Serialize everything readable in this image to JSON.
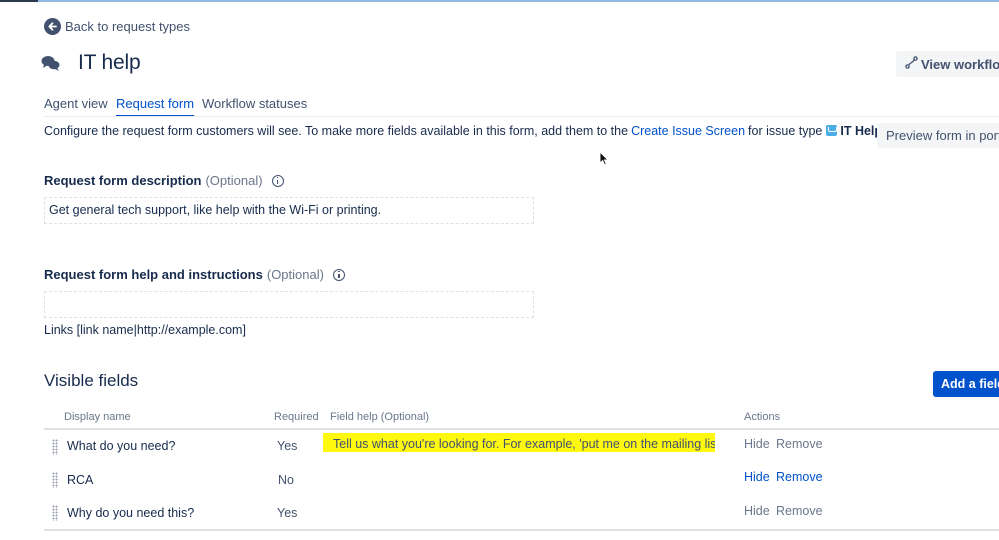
{
  "header": {
    "back_label": "Back to request types",
    "title": "IT help",
    "view_workflow_label": "View workflow",
    "title_icon": "chat-bubbles-icon"
  },
  "tabs": [
    {
      "label": "Agent view",
      "active": false
    },
    {
      "label": "Request form",
      "active": true
    },
    {
      "label": "Workflow statuses",
      "active": false
    }
  ],
  "config": {
    "text_before": "Configure the request form customers will see. To make more fields available in this form, add them to the",
    "link": "Create Issue Screen",
    "text_mid": "for issue type",
    "issue_type": "IT Help",
    "text_end": ".",
    "preview_label": "Preview form in portal"
  },
  "description": {
    "label": "Request form description",
    "optional": "(Optional)",
    "value": "Get general tech support, like help with the Wi-Fi or printing."
  },
  "instructions": {
    "label": "Request form help and instructions",
    "optional": "(Optional)",
    "value": "",
    "links_hint": "Links [link name|http://example.com]"
  },
  "visible_fields": {
    "title": "Visible fields",
    "add_label": "Add a field",
    "columns": {
      "display_name": "Display name",
      "required": "Required",
      "field_help": "Field help (Optional)",
      "actions": "Actions"
    },
    "rows": [
      {
        "name": "What do you need?",
        "required": "Yes",
        "help": "Tell us what you're looking for. For example, 'put me on the mailing list'.",
        "hide": "Hide",
        "remove": "Remove",
        "actions_active": false
      },
      {
        "name": "RCA",
        "required": "No",
        "help": "",
        "hide": "Hide",
        "remove": "Remove",
        "actions_active": true
      },
      {
        "name": "Why do you need this?",
        "required": "Yes",
        "help": "",
        "hide": "Hide",
        "remove": "Remove",
        "actions_active": false
      }
    ]
  },
  "colors": {
    "link": "#0052CC",
    "primary_button": "#0052CC",
    "highlight": "#FFF80F",
    "text": "#172B4D"
  }
}
